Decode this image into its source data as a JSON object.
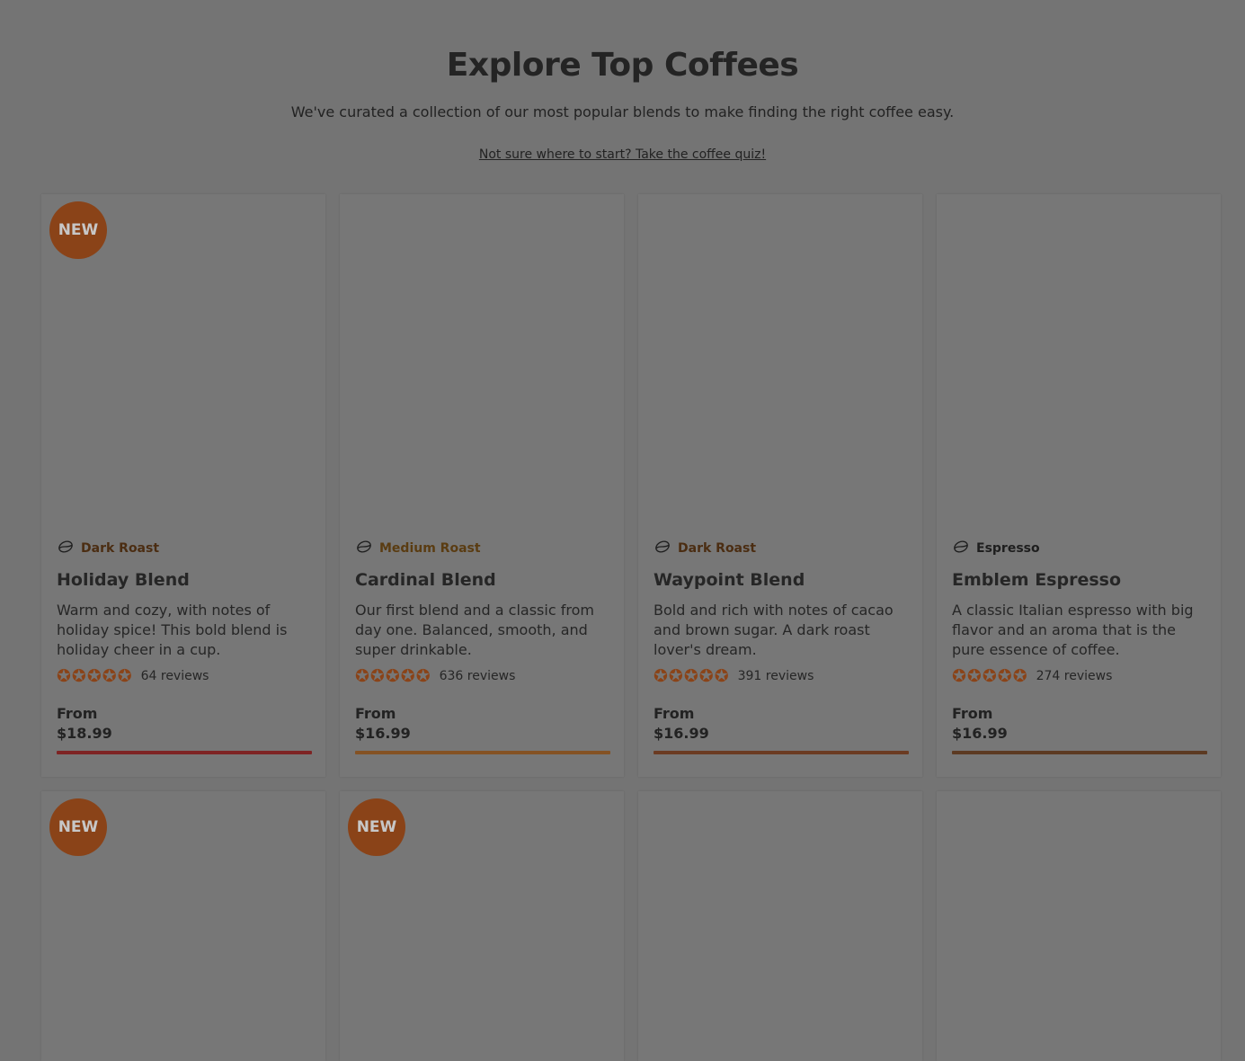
{
  "header": {
    "title": "Explore Top Coffees",
    "subtitle": "We've curated a collection of our most popular blends to make finding the right coffee easy.",
    "quiz_link": "Not sure where to start? Take the coffee quiz!"
  },
  "colors": {
    "badge": "#8a4318",
    "star": "#8a4318"
  },
  "products": [
    {
      "badge": "NEW",
      "roast": "Dark Roast",
      "roast_color": "#4b2d12",
      "name": "Holiday Blend",
      "description": "Warm and cozy, with notes of holiday spice! This bold blend is holiday cheer in a cup.",
      "rating": 5,
      "reviews": "64 reviews",
      "from_label": "From",
      "price": "$18.99",
      "bar_color": "#7e2424"
    },
    {
      "badge": "",
      "roast": "Medium Roast",
      "roast_color": "#5a3c12",
      "name": "Cardinal Blend",
      "description": "Our first blend and a classic from day one. Balanced, smooth, and super drinkable.",
      "rating": 5,
      "reviews": "636 reviews",
      "from_label": "From",
      "price": "$16.99",
      "bar_color": "#845224"
    },
    {
      "badge": "",
      "roast": "Dark Roast",
      "roast_color": "#4b2d12",
      "name": "Waypoint Blend",
      "description": "Bold and rich with notes of cacao and brown sugar. A dark roast lover's dream.",
      "rating": 5,
      "reviews": "391 reviews",
      "from_label": "From",
      "price": "$16.99",
      "bar_color": "#6b3b22"
    },
    {
      "badge": "",
      "roast": "Espresso",
      "roast_color": "#1e1e1e",
      "name": "Emblem Espresso",
      "description": "A classic Italian espresso with big flavor and an aroma that is the pure essence of coffee.",
      "rating": 5,
      "reviews": "274 reviews",
      "from_label": "From",
      "price": "$16.99",
      "bar_color": "#5c3a22"
    }
  ],
  "second_row": [
    {
      "badge": "NEW"
    },
    {
      "badge": "NEW"
    },
    {
      "badge": ""
    },
    {
      "badge": ""
    }
  ]
}
